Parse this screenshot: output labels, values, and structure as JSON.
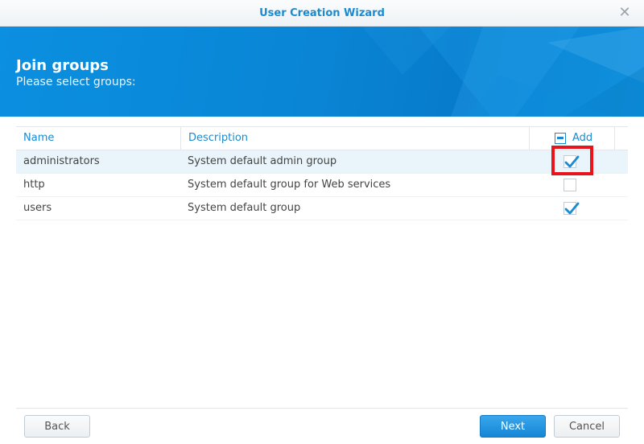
{
  "window": {
    "title": "User Creation Wizard",
    "close_icon": "close-icon"
  },
  "banner": {
    "heading": "Join groups",
    "subheading": "Please select groups:"
  },
  "table": {
    "columns": {
      "name": "Name",
      "description": "Description",
      "add": "Add"
    },
    "header_checkbox_state": "partial",
    "rows": [
      {
        "name": "administrators",
        "description": "System default admin group",
        "checked": true
      },
      {
        "name": "http",
        "description": "System default group for Web services",
        "checked": false
      },
      {
        "name": "users",
        "description": "System default group",
        "checked": true
      }
    ]
  },
  "footer": {
    "back_label": "Back",
    "next_label": "Next",
    "cancel_label": "Cancel"
  },
  "colors": {
    "accent": "#1a8bd0",
    "banner": "#0a86d6",
    "highlight": "#e8141c"
  }
}
